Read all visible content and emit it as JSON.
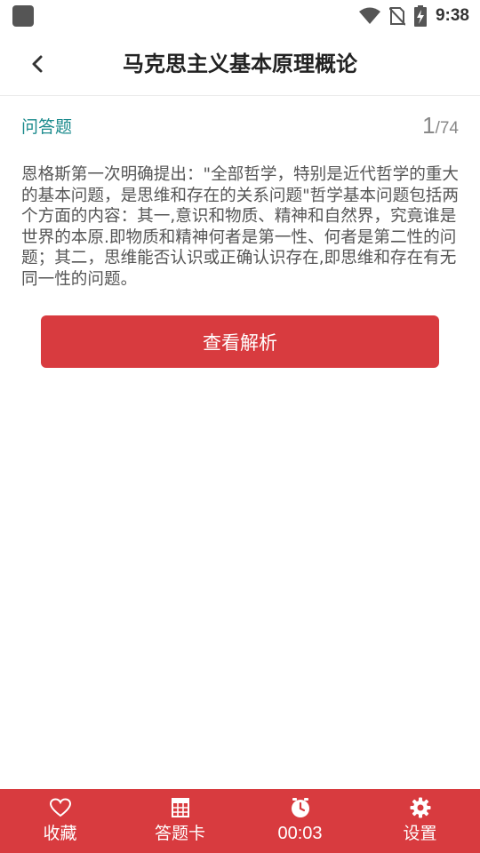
{
  "status_bar": {
    "time": "9:38",
    "icons": [
      "app-icon",
      "wifi-icon",
      "no-sim-icon",
      "battery-charging-icon"
    ]
  },
  "header": {
    "title": "马克思主义基本原理概论",
    "back_icon": "chevron-left-icon"
  },
  "question": {
    "type_label": "问答题",
    "current": "1",
    "total": "/74",
    "text": "恩格斯第一次明确提出：\"全部哲学，特别是近代哲学的重大的基本问题，是思维和存在的关系问题\"哲学基本问题包括两个方面的内容：其一,意识和物质、精神和自然界，究竟谁是世界的本原.即物质和精神何者是第一性、何者是第二性的问题；其二，思维能否认识或正确认识存在,即思维和存在有无同一性的问题。"
  },
  "analysis_button": {
    "label": "查看解析"
  },
  "bottom_nav": {
    "items": [
      {
        "label": "收藏",
        "icon": "heart-icon"
      },
      {
        "label": "答题卡",
        "icon": "grid-card-icon"
      },
      {
        "label": "00:03",
        "icon": "clock-icon"
      },
      {
        "label": "设置",
        "icon": "gear-icon"
      }
    ]
  },
  "colors": {
    "accent": "#d83b3f",
    "question_type": "#1a8a8c",
    "text": "#555555"
  }
}
